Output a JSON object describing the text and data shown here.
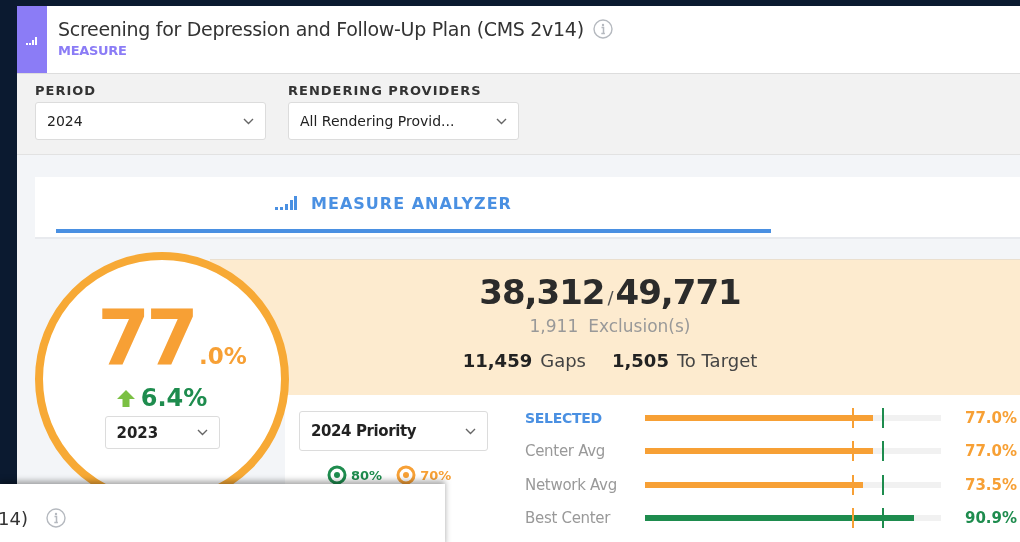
{
  "header": {
    "title": "Screening for Depression and Follow-Up Plan (CMS 2v14)",
    "subtitle": "MEASURE"
  },
  "filters": [
    {
      "label": "PERIOD",
      "value": "2024"
    },
    {
      "label": "RENDERING PROVIDERS",
      "value": "All Rendering Provid..."
    }
  ],
  "tabs": [
    {
      "label": "MEASURE ANALYZER",
      "selected": true
    }
  ],
  "score": {
    "whole": "77",
    "fraction": ".0%",
    "change": "6.4%",
    "increased": true,
    "compare_period": "2023"
  },
  "summary": {
    "numerator": "38,312",
    "separator": "/",
    "denominator": "49,771",
    "exclusions": "1,911",
    "exclusions_label": "Exclusion(s)",
    "gaps": "11,459",
    "gaps_label": "Gaps",
    "to_target": "1,505",
    "to_target_label": "To Target"
  },
  "priority": {
    "value": "2024 Priority"
  },
  "targets": [
    {
      "label": "80%",
      "level": 0.8,
      "color": "#1e8c4e"
    },
    {
      "label": "70%",
      "level": 0.7,
      "color": "#f7a035"
    }
  ],
  "comparisons": [
    {
      "label": "SELECTED",
      "selected": true,
      "level": 0.77,
      "reading": "77.0%",
      "color": "#f7a035"
    },
    {
      "label": "Center Avg",
      "selected": false,
      "level": 0.77,
      "reading": "77.0%",
      "color": "#f7a035"
    },
    {
      "label": "Network Avg",
      "selected": false,
      "level": 0.735,
      "reading": "73.5%",
      "color": "#f7a035"
    },
    {
      "label": "Best Center",
      "selected": false,
      "level": 0.909,
      "reading": "90.9%",
      "color": "#1e8c4e"
    }
  ],
  "background_window": {
    "title_fragment": "14)"
  }
}
